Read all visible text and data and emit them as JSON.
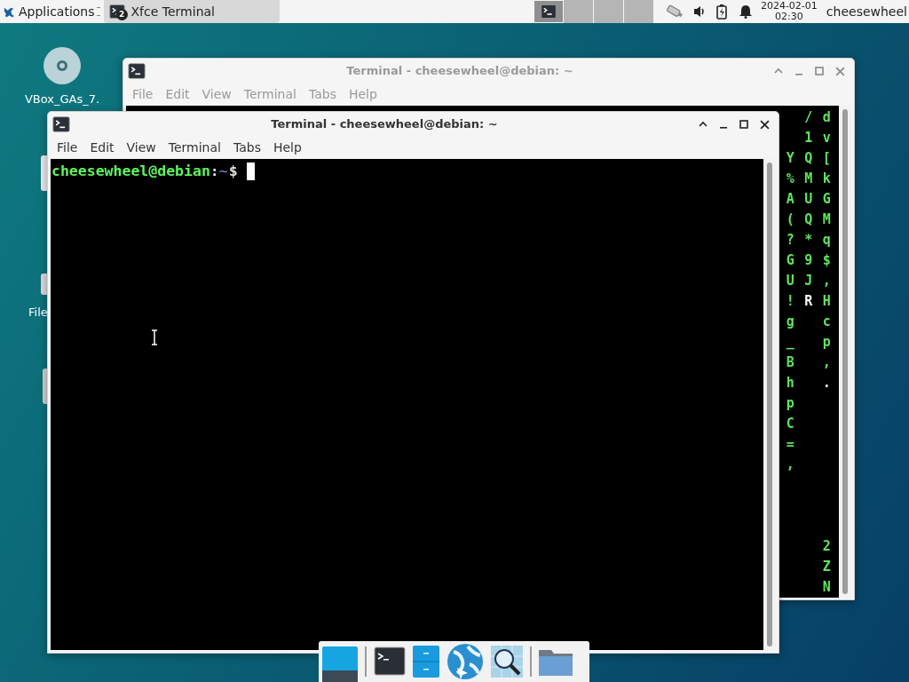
{
  "top_panel": {
    "applications_label": "Applications",
    "task": {
      "label": "Xfce Terminal",
      "badge": "2",
      "selected": true
    },
    "workspaces": [
      {
        "selected": true
      },
      {
        "selected": false
      },
      {
        "selected": false
      },
      {
        "selected": false
      }
    ],
    "clock": {
      "date": "2024-02-01",
      "time": "02:30"
    },
    "user": "cheesewheel"
  },
  "desktop_icons": [
    {
      "label": "VBox_GAs_7."
    },
    {
      "label": "File"
    }
  ],
  "windows": [
    {
      "title": "Terminal - cheesewheel@debian: ~",
      "active": false,
      "menu": [
        "File",
        "Edit",
        "View",
        "Terminal",
        "Tabs",
        "Help"
      ],
      "matrix_columns": [
        {
          "runs": [
            {
              "text": "  Y%A(?GU!g_BhpC=,",
              "bright": false
            }
          ]
        },
        {
          "runs": [
            {
              "text": "/1QMUQ*9J",
              "bright": false
            },
            {
              "text": "R",
              "bright": true
            }
          ]
        },
        {
          "runs": [
            {
              "text": "dv[kGMq$,Hcp,",
              "bright": false
            },
            {
              "text": ".",
              "bright": true
            },
            {
              "text": "       2ZN",
              "bright": false
            }
          ]
        }
      ]
    },
    {
      "title": "Terminal - cheesewheel@debian: ~",
      "active": true,
      "menu": [
        "File",
        "Edit",
        "View",
        "Terminal",
        "Tabs",
        "Help"
      ],
      "prompt": {
        "user_host": "cheesewheel@debian",
        "separator": ":",
        "path": "~",
        "symbol": "$"
      }
    }
  ],
  "dock": {
    "items": [
      {
        "kind": "desktop"
      },
      {
        "kind": "separator"
      },
      {
        "kind": "terminal"
      },
      {
        "kind": "files"
      },
      {
        "kind": "browser"
      },
      {
        "kind": "search"
      },
      {
        "kind": "separator"
      },
      {
        "kind": "folder"
      }
    ]
  }
}
